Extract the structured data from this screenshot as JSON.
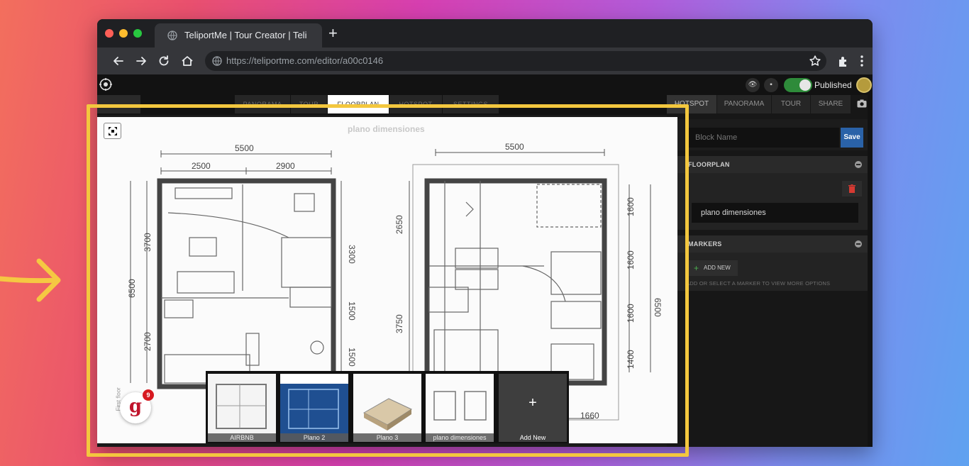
{
  "browser": {
    "tab_title": "TeliportMe | Tour Creator | Teli",
    "url": "https://teliportme.com/editor/a00c0146"
  },
  "app": {
    "published_label": "Published",
    "top_tabs": [
      {
        "label": "PANORAMA"
      },
      {
        "label": "TOUR"
      },
      {
        "label": "FLOORPLAN",
        "active": true
      },
      {
        "label": "HOTSPOT"
      },
      {
        "label": "SETTINGS"
      }
    ]
  },
  "panel": {
    "tabs": [
      "HOTSPOT",
      "PANORAMA",
      "TOUR",
      "SHARE"
    ],
    "block_name_placeholder": "Block Name",
    "save_label": "Save",
    "floorplan_header": "FLOORPLAN",
    "floorplan_name": "plano dimensiones",
    "markers_header": "MARKERS",
    "add_new_label": "ADD NEW",
    "markers_hint": "ADD OR SELECT A MARKER TO VIEW MORE OPTIONS"
  },
  "viewer": {
    "title": "plano dimensiones",
    "first_floor_label": "First floor",
    "badge_letter": "g",
    "badge_count": "9",
    "dims": {
      "top_left_total": "5500",
      "top_left_a": "2500",
      "top_left_b": "2900",
      "top_right_total": "5500",
      "left_total": "6500",
      "left_a": "3700",
      "left_b": "2700",
      "mid_a": "3300",
      "mid_b": "1500",
      "mid_c": "1500",
      "right_a": "2650",
      "right_b": "3750",
      "far_total": "6500",
      "far_a": "1600",
      "far_b": "1600",
      "far_c": "1600",
      "far_d": "1400",
      "bottom_right": "1660"
    },
    "thumbnails": [
      {
        "label": "AIRBNB"
      },
      {
        "label": "Plano 2"
      },
      {
        "label": "Plano 3"
      },
      {
        "label": "plano dimensiones"
      },
      {
        "label": "Add New"
      }
    ]
  }
}
